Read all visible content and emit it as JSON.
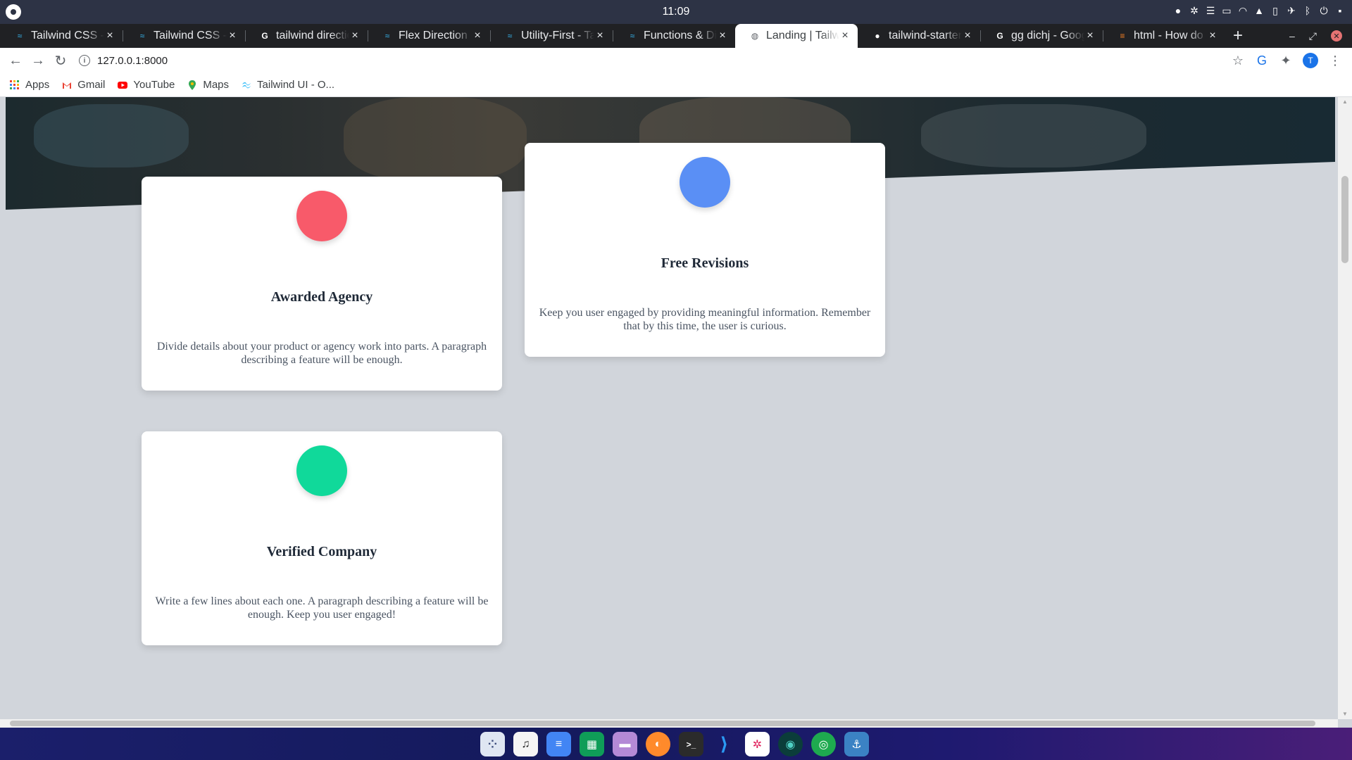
{
  "os": {
    "clock": "11:09"
  },
  "tabs": [
    {
      "title": "Tailwind CSS - R",
      "favicon": "tailwind-favicon"
    },
    {
      "title": "Tailwind CSS - R",
      "favicon": "tailwind-favicon"
    },
    {
      "title": "tailwind directio",
      "favicon": "google-favicon"
    },
    {
      "title": "Flex Direction -",
      "favicon": "tailwind-favicon"
    },
    {
      "title": "Utility-First - Tai",
      "favicon": "tailwind-favicon"
    },
    {
      "title": "Functions & Dir",
      "favicon": "tailwind-favicon"
    },
    {
      "title": "Landing | Tailw",
      "favicon": "globe-favicon",
      "active": true
    },
    {
      "title": "tailwind-starter",
      "favicon": "github-favicon"
    },
    {
      "title": "gg dichj - Googl",
      "favicon": "google-favicon"
    },
    {
      "title": "html - How do p",
      "favicon": "stackoverflow-favicon"
    }
  ],
  "toolbar": {
    "url": "127.0.0.1:8000"
  },
  "bookmarks": [
    {
      "label": "Apps",
      "icon": "apps-grid-icon"
    },
    {
      "label": "Gmail",
      "icon": "gmail-icon"
    },
    {
      "label": "YouTube",
      "icon": "youtube-icon"
    },
    {
      "label": "Maps",
      "icon": "maps-icon"
    },
    {
      "label": "Tailwind UI - O...",
      "icon": "tailwind-icon"
    }
  ],
  "profile_initial": "T",
  "cards": [
    {
      "title": "Awarded Agency",
      "text": "Divide details about your product or agency work into parts. A paragraph describing a feature will be enough.",
      "color": "#f85a6a"
    },
    {
      "title": "Free Revisions",
      "text": "Keep you user engaged by providing meaningful information. Remember that by this time, the user is curious.",
      "color": "#5a8ff5"
    },
    {
      "title": "Verified Company",
      "text": "Write a few lines about each one. A paragraph describing a feature will be enough. Keep you user engaged!",
      "color": "#10d99a"
    }
  ],
  "colors": {
    "tab_strip": "#202124",
    "os_bar": "#2d3345",
    "page_bg": "#d1d5db"
  },
  "dock_apps": [
    "launcher-icon",
    "music-icon",
    "docs-icon",
    "sheets-icon",
    "files-icon",
    "firefox-icon",
    "terminal-icon",
    "vscode-icon",
    "slack-icon",
    "gitkraken-icon",
    "chrome-icon",
    "anchor-icon"
  ]
}
